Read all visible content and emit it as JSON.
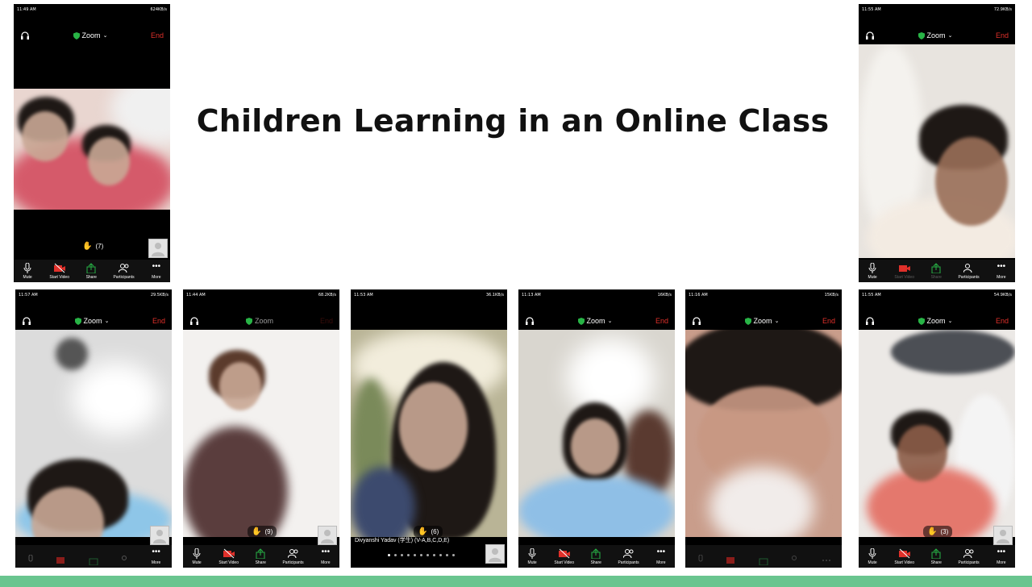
{
  "slide": {
    "title": "Children Learning in an Online Class"
  },
  "zoom_ui": {
    "meeting_title": "Zoom",
    "end_label": "End",
    "icons": {
      "audio": "headphones-icon",
      "secure": "shield-icon",
      "title_dropdown": "chevron-down-icon"
    },
    "colors": {
      "end": "#e0302a",
      "secure": "#28b446",
      "bottom_bar": "#69c58f"
    },
    "toolbar": {
      "mute": "Mute",
      "start_video": "Start Video",
      "share": "Share",
      "participants": "Participants",
      "more": "More"
    }
  },
  "phones": [
    {
      "time": "11:49 AM",
      "net": "624KB/s",
      "raised_hands": "(7)"
    },
    {
      "time": "11:55 AM",
      "net": "72.9KB/s"
    },
    {
      "time": "11:57 AM",
      "net": "29.5KB/s"
    },
    {
      "time": "11:44 AM",
      "net": "68.2KB/s"
    },
    {
      "time": "11:53 AM",
      "net": "36.1KB/s",
      "raised_hands": "(6)",
      "participant_name": "Divyanshi Yadav (学生) (V-A,B,C,D,E)"
    },
    {
      "time": "11:13 AM",
      "net": "16KB/s"
    },
    {
      "time": "11:16 AM",
      "net": "15KB/s"
    },
    {
      "time": "11:55 AM",
      "net": "54.9KB/s",
      "raised_hands": "(3)"
    },
    {
      "raised_hands": "(9)"
    }
  ]
}
